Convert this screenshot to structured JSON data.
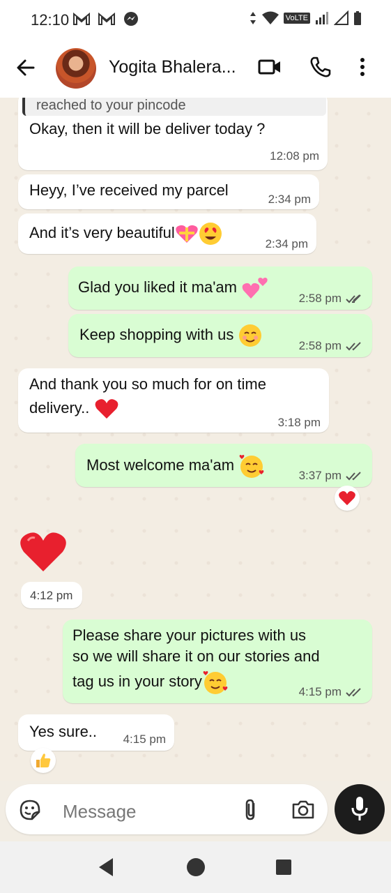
{
  "status_bar": {
    "time": "12:10",
    "notif_icons": [
      "gmail-icon",
      "gmail-icon",
      "messenger-icon"
    ],
    "right_icons": [
      "data-arrows-icon",
      "wifi-icon",
      "volte-badge",
      "signal-icon",
      "signal-empty-icon",
      "battery-icon"
    ],
    "volte_label": "VoLTE"
  },
  "app_bar": {
    "contact_name": "Yogita Bhalera..."
  },
  "messages": [
    {
      "direction": "in",
      "quote": "reached to your pincode",
      "text": "Okay, then it will be deliver today ?",
      "time": "12:08 pm"
    },
    {
      "direction": "in",
      "text": "Heyy, I’ve received my parcel",
      "time": "2:34 pm"
    },
    {
      "direction": "in",
      "text": "And it’s very beautiful",
      "emojis": [
        "gift-heart-emoji",
        "heart-eyes-emoji"
      ],
      "time": "2:34 pm"
    },
    {
      "direction": "out",
      "text": "Glad you liked it ma'am",
      "emojis": [
        "two-hearts-emoji"
      ],
      "time": "2:58 pm",
      "read": true
    },
    {
      "direction": "out",
      "text": "Keep shopping with us",
      "emojis": [
        "smiling-blush-emoji"
      ],
      "time": "2:58 pm",
      "read": true
    },
    {
      "direction": "in",
      "text_line1": "And thank you so much for on time",
      "text_line2": "delivery..",
      "emojis": [
        "red-heart-emoji"
      ],
      "time": "3:18 pm"
    },
    {
      "direction": "out",
      "text": "Most welcome ma'am",
      "emojis": [
        "smiling-hearts-emoji"
      ],
      "time": "3:37 pm",
      "read": true,
      "reaction": "red-heart-emoji"
    },
    {
      "direction": "in",
      "big_emoji": "red-heart-emoji",
      "time": "4:12 pm"
    },
    {
      "direction": "out",
      "text_line1": "Please share your pictures with us",
      "text_line2": "so we will share it on our stories and",
      "text_line3": "tag us in your story",
      "emojis": [
        "smiling-hearts-emoji"
      ],
      "time": "4:15 pm",
      "read": true
    },
    {
      "direction": "in",
      "text": "Yes sure..",
      "time": "4:15 pm",
      "reaction": "thumbs-up-emoji"
    }
  ],
  "input": {
    "placeholder": "Message"
  },
  "colors": {
    "outgoing_bubble": "#d9fdd3",
    "incoming_bubble": "#ffffff",
    "chat_background": "#f3ede3",
    "read_tick": "#555555"
  }
}
